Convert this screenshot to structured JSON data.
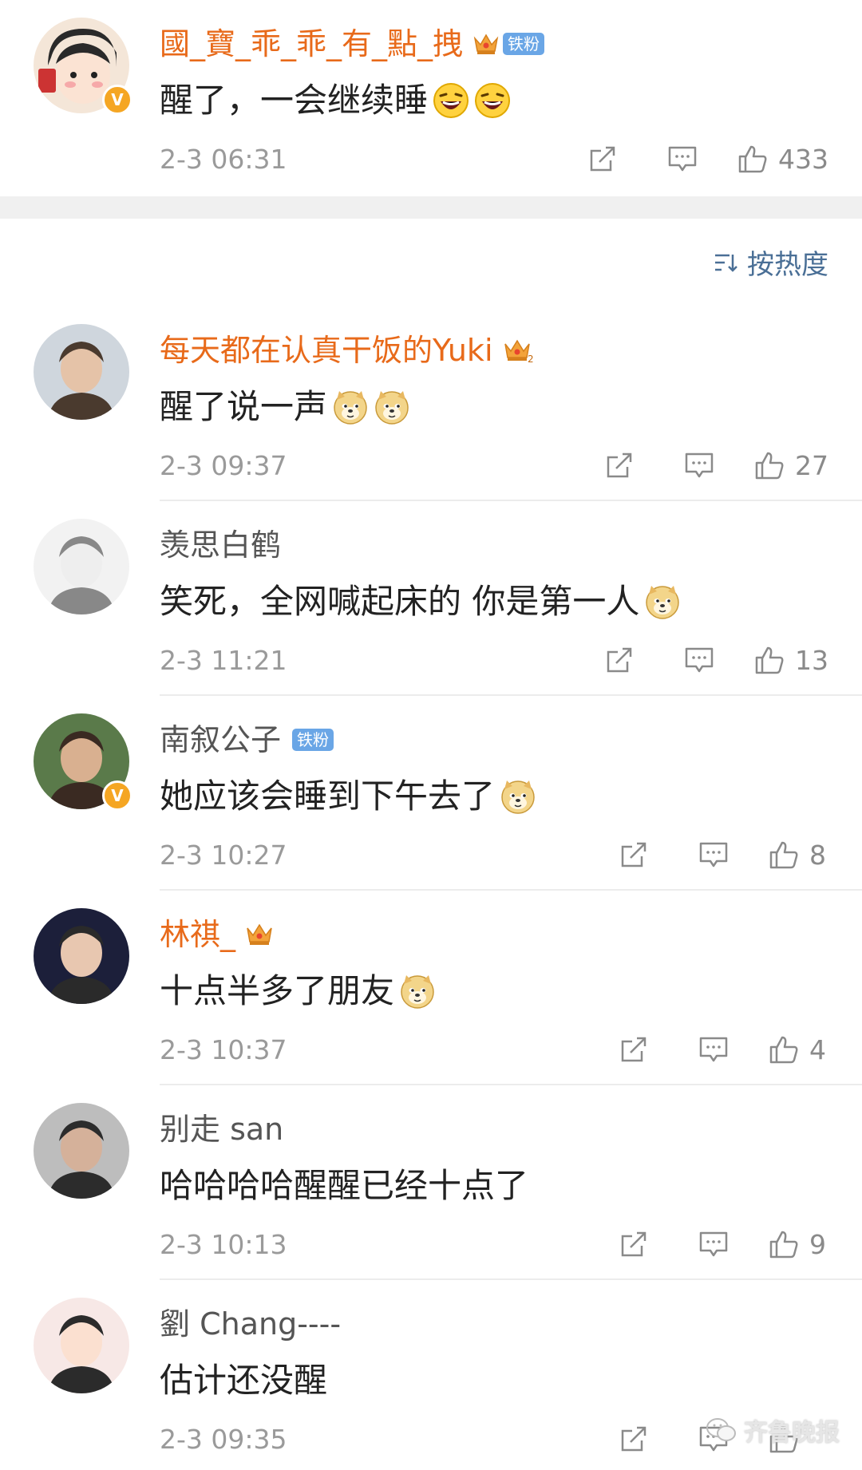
{
  "top_comment": {
    "username": "國_寶_乖_乖_有_點_拽",
    "fan_badge": "铁粉",
    "verified": "V",
    "text": "醒了，一会继续睡",
    "emojis": [
      "laugh-emoji",
      "laugh-emoji"
    ],
    "time": "2-3 06:31",
    "likes": "433"
  },
  "sort": {
    "label": "按热度"
  },
  "comments": [
    {
      "username": "每天都在认真干饭的Yuki",
      "name_color": "#e86a1a",
      "has_crown": true,
      "crown_level": "2",
      "fan_badge": "",
      "verified": "",
      "text": "醒了说一声",
      "emojis": [
        "doge-emoji",
        "doge-emoji"
      ],
      "time": "2-3 09:37",
      "likes": "27"
    },
    {
      "username": "羡思白鹤",
      "name_color": "#555555",
      "has_crown": false,
      "fan_badge": "",
      "verified": "",
      "text": "笑死，全网喊起床的 你是第一人",
      "emojis": [
        "doge-emoji"
      ],
      "time": "2-3 11:21",
      "likes": "13"
    },
    {
      "username": "南叙公子",
      "name_color": "#555555",
      "has_crown": false,
      "fan_badge": "铁粉",
      "verified": "V",
      "text": "她应该会睡到下午去了",
      "emojis": [
        "doge-emoji"
      ],
      "time": "2-3 10:27",
      "likes": "8"
    },
    {
      "username": "林祺_",
      "name_color": "#e86a1a",
      "has_crown": true,
      "crown_level": "",
      "fan_badge": "",
      "verified": "",
      "text": "十点半多了朋友",
      "emojis": [
        "doge-emoji"
      ],
      "time": "2-3 10:37",
      "likes": "4"
    },
    {
      "username": "别走 san",
      "name_color": "#555555",
      "has_crown": false,
      "fan_badge": "",
      "verified": "",
      "text": "哈哈哈哈醒醒已经十点了",
      "emojis": [],
      "time": "2-3 10:13",
      "likes": "9"
    },
    {
      "username": "劉 Chang----",
      "name_color": "#555555",
      "has_crown": false,
      "fan_badge": "",
      "verified": "",
      "text": "估计还没醒",
      "emojis": [],
      "time": "2-3 09:35",
      "likes": ""
    }
  ],
  "watermark": {
    "text": "齐鲁晚报"
  },
  "colors": {
    "orange_name": "#e86a1a",
    "gray_name": "#555555",
    "sort_blue": "#4a6f96",
    "fan_tag": "#6aa6e6",
    "meta_gray": "#9a9a9a"
  }
}
